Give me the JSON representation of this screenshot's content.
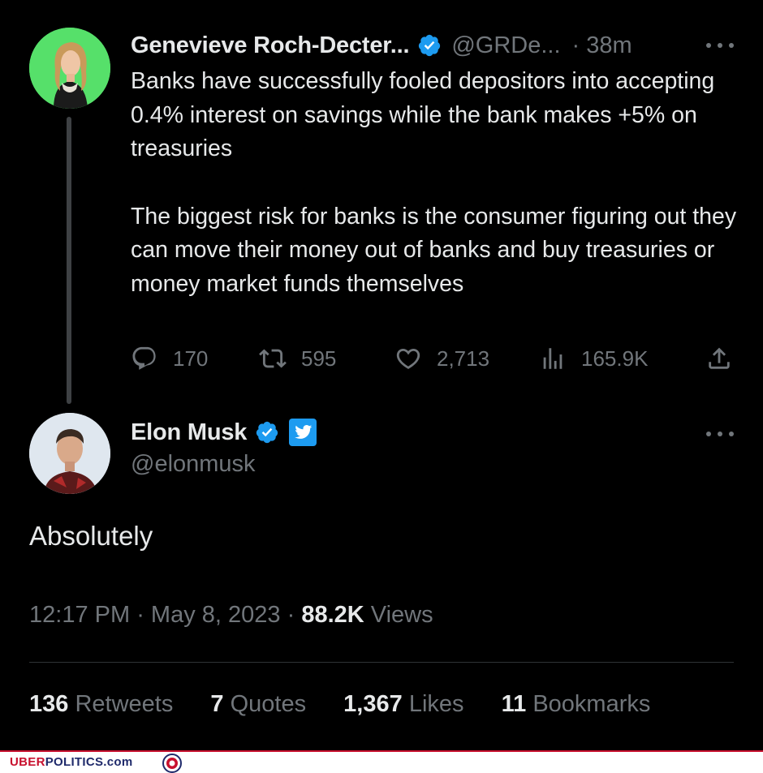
{
  "parent_tweet": {
    "author_name": "Genevieve Roch-Decter...",
    "handle": "@GRDe...",
    "time": "· 38m",
    "paragraphs": [
      "Banks have successfully fooled depositors into accepting 0.4% interest on savings while the bank makes +5% on treasuries",
      "The biggest risk for banks is the consumer figuring out they can move their money out of banks and buy treasuries or money market funds themselves"
    ],
    "actions": {
      "replies": "170",
      "retweets": "595",
      "likes": "2,713",
      "views": "165.9K"
    },
    "icons": [
      "verified-badge-icon",
      "more-icon",
      "reply-icon",
      "retweet-icon",
      "like-icon",
      "views-icon",
      "share-icon"
    ]
  },
  "main_tweet": {
    "author_name": "Elon Musk",
    "handle": "@elonmusk",
    "text": "Absolutely",
    "time": "12:17 PM",
    "date": "May 8, 2023",
    "views_count": "88.2K",
    "views_label": "Views",
    "stats": [
      {
        "count": "136",
        "label": "Retweets"
      },
      {
        "count": "7",
        "label": "Quotes"
      },
      {
        "count": "1,367",
        "label": "Likes"
      },
      {
        "count": "11",
        "label": "Bookmarks"
      }
    ]
  },
  "watermark": {
    "part1": "UBER",
    "part2": "POLITICS.com"
  },
  "colors": {
    "background": "#000000",
    "text_primary": "#e7e9ea",
    "text_secondary": "#71767b",
    "verified_blue": "#1d9bf0",
    "divider": "#2f3336"
  }
}
